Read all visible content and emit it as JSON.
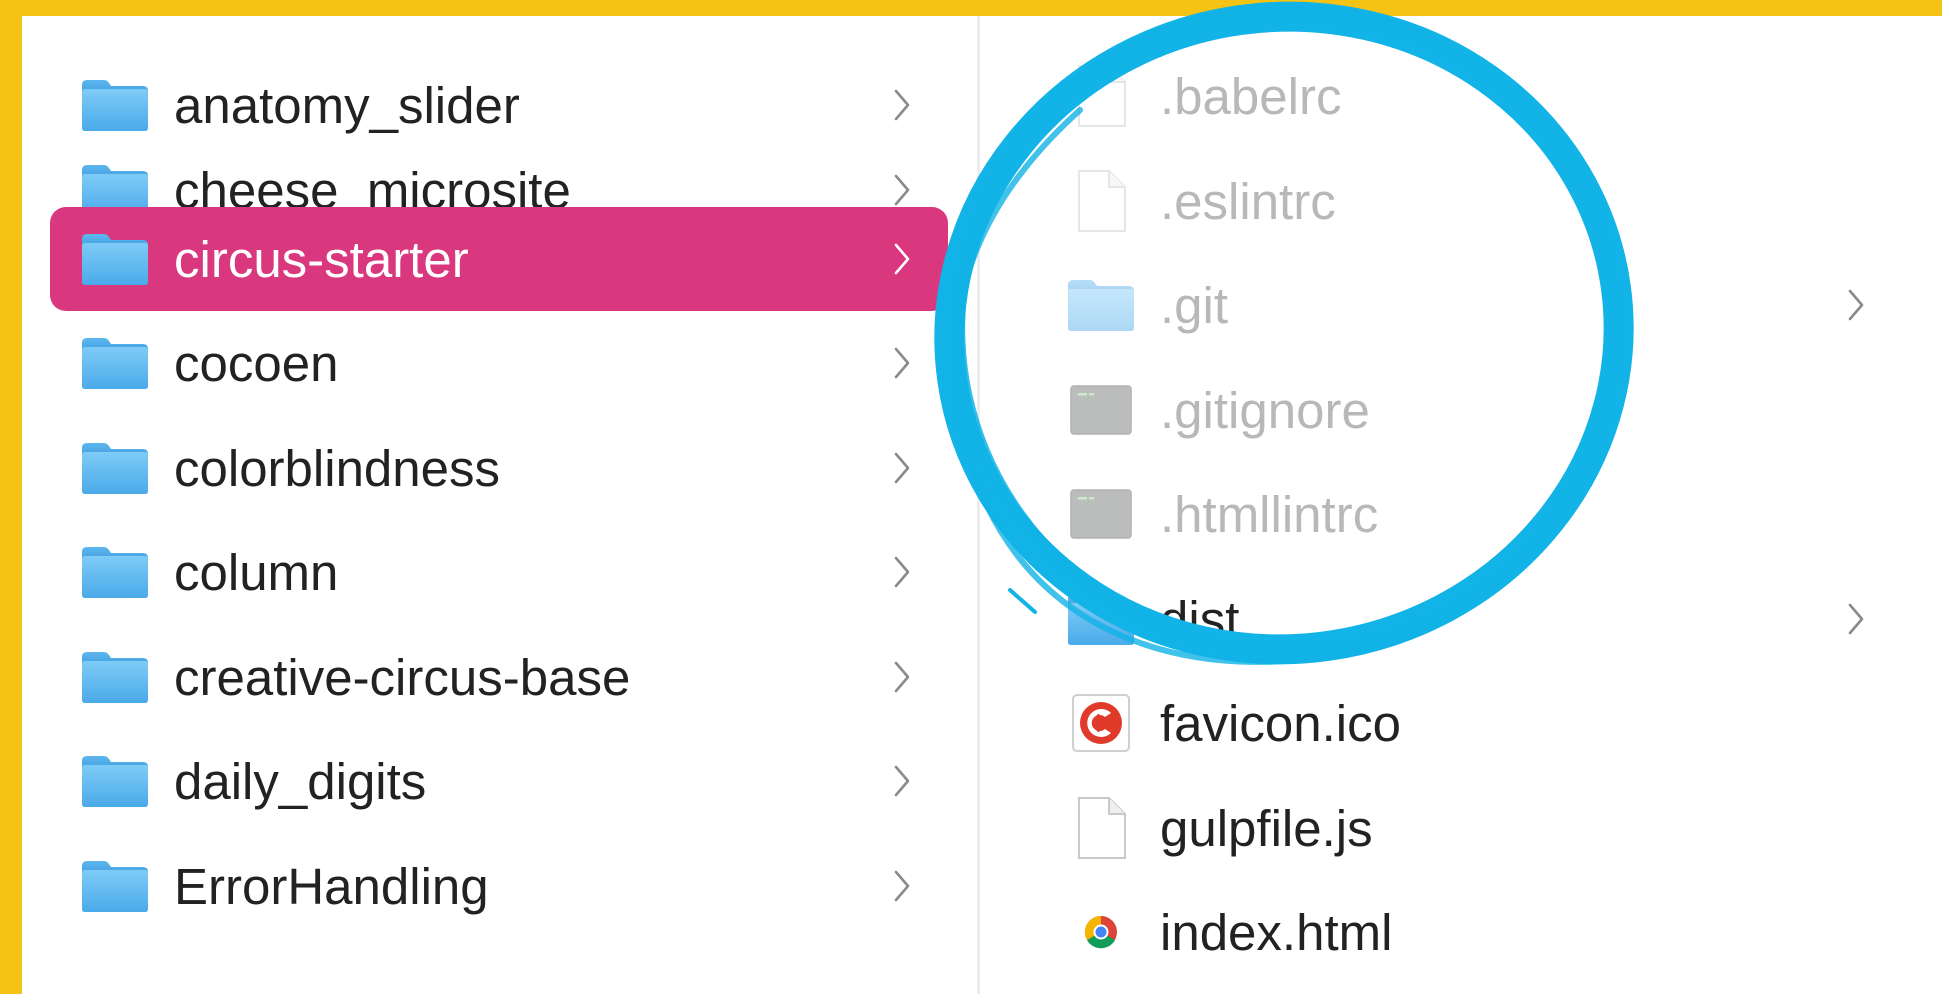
{
  "accent_color": "#D9387E",
  "background_color": "#F5C314",
  "annotation_color": "#12B3E6",
  "left_column": {
    "items": [
      {
        "label": "anatomy_slider",
        "icon": "folder-icon",
        "selected": false
      },
      {
        "label": "cheese_microsite",
        "icon": "folder-icon",
        "selected": false
      },
      {
        "label": "circus-starter",
        "icon": "folder-icon",
        "selected": true
      },
      {
        "label": "cocoen",
        "icon": "folder-icon",
        "selected": false
      },
      {
        "label": "colorblindness",
        "icon": "folder-icon",
        "selected": false
      },
      {
        "label": "column",
        "icon": "folder-icon",
        "selected": false
      },
      {
        "label": "creative-circus-base",
        "icon": "folder-icon",
        "selected": false
      },
      {
        "label": "daily_digits",
        "icon": "folder-icon",
        "selected": false
      },
      {
        "label": "ErrorHandling",
        "icon": "folder-icon",
        "selected": false
      }
    ]
  },
  "right_column": {
    "items": [
      {
        "label": ".babelrc",
        "icon": "file-icon",
        "hidden": true,
        "has_children": false
      },
      {
        "label": ".eslintrc",
        "icon": "file-icon",
        "hidden": true,
        "has_children": false
      },
      {
        "label": ".git",
        "icon": "folder-icon",
        "hidden": true,
        "has_children": true
      },
      {
        "label": ".gitignore",
        "icon": "terminal-file-icon",
        "hidden": true,
        "has_children": false
      },
      {
        "label": ".htmllintrc",
        "icon": "terminal-file-icon",
        "hidden": true,
        "has_children": false
      },
      {
        "label": "dist",
        "icon": "folder-icon",
        "hidden": false,
        "has_children": true
      },
      {
        "label": "favicon.ico",
        "icon": "favicon-icon",
        "hidden": false,
        "has_children": false
      },
      {
        "label": "gulpfile.js",
        "icon": "file-icon",
        "hidden": false,
        "has_children": false
      },
      {
        "label": "index.html",
        "icon": "chrome-html-icon",
        "hidden": false,
        "has_children": false
      }
    ]
  }
}
